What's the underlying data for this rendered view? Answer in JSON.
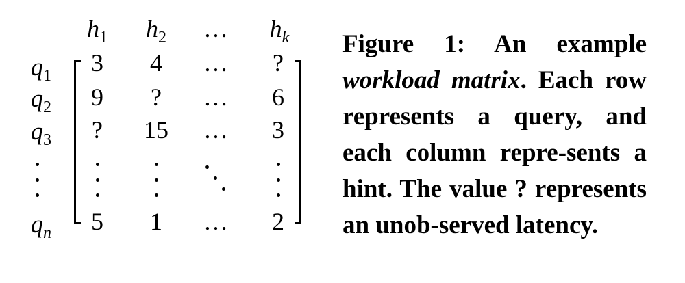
{
  "matrix": {
    "col_headers": [
      {
        "base": "h",
        "sub": "1"
      },
      {
        "base": "h",
        "sub": "2"
      },
      {
        "base": "…",
        "sub": ""
      },
      {
        "base": "h",
        "sub": "k"
      }
    ],
    "row_labels": [
      {
        "base": "q",
        "sub": "1"
      },
      {
        "base": "q",
        "sub": "2"
      },
      {
        "base": "q",
        "sub": "3"
      },
      {
        "base": "⋮",
        "sub": ""
      },
      {
        "base": "q",
        "sub": "n"
      }
    ],
    "rows": [
      [
        "3",
        "4",
        "…",
        "?"
      ],
      [
        "9",
        "?",
        "…",
        "6"
      ],
      [
        "?",
        "15",
        "…",
        "3"
      ],
      [
        "⋮",
        "⋮",
        "⋱",
        "⋮"
      ],
      [
        "5",
        "1",
        "…",
        "2"
      ]
    ]
  },
  "caption": {
    "label": "Figure 1:",
    "part1": "An example",
    "italic": "workload matrix",
    "part2": ". Each row represents a query, and each column repre-sents a hint. The value ? represents an unob-served latency."
  }
}
